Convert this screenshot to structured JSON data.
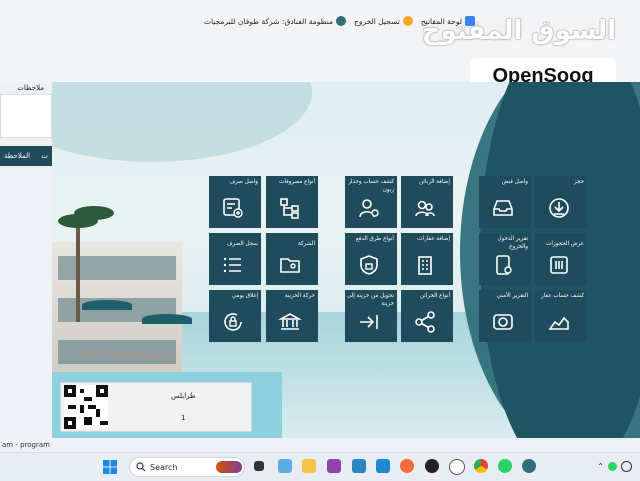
{
  "titlebar": {
    "system_name": "منظومة الفنادق: شركة طوفان للبرمجيات",
    "logout": "تسجيل الخروج",
    "keyboard": "لوحة المفاتيح"
  },
  "watermark": {
    "arabic": "السوق المفتوح",
    "english": "OpenSooq"
  },
  "sidebar": {
    "notes_label": "ملاحظات",
    "notes_tab_label": "الملاحظة",
    "notes_tab_short": "ت"
  },
  "tiles": {
    "book": "حجز",
    "receipt_voucher": "واصل قبض",
    "bookings_view": "عرض الحجوزات",
    "checkin_report": "تقرير الدخول والخروج",
    "property_statement": "كشف حساب عقار",
    "security_report": "التقرير الأمني",
    "add_customers": "إضافة الزبائن",
    "customer_statement": "كشف حساب وحذار زبون",
    "add_properties": "إضافة عقارات",
    "payment_methods": "أنواع طرق الدفع",
    "treasury_types": "أنواع الخزائن",
    "treasury_transfer": "تحويل من خزينة إلى خزينة",
    "expense_types": "أنواع مصروفات",
    "payment_voucher": "واصل صرف",
    "company": "الشركة",
    "expense_log": "سجل الصرف",
    "treasury_movement": "حركة الخزينة",
    "daily_close": "إغلاق يومي"
  },
  "infobox": {
    "city": "طرابلس",
    "number": "1"
  },
  "statusbar": {
    "text": "am - program"
  },
  "taskbar": {
    "search_placeholder": "Search"
  }
}
